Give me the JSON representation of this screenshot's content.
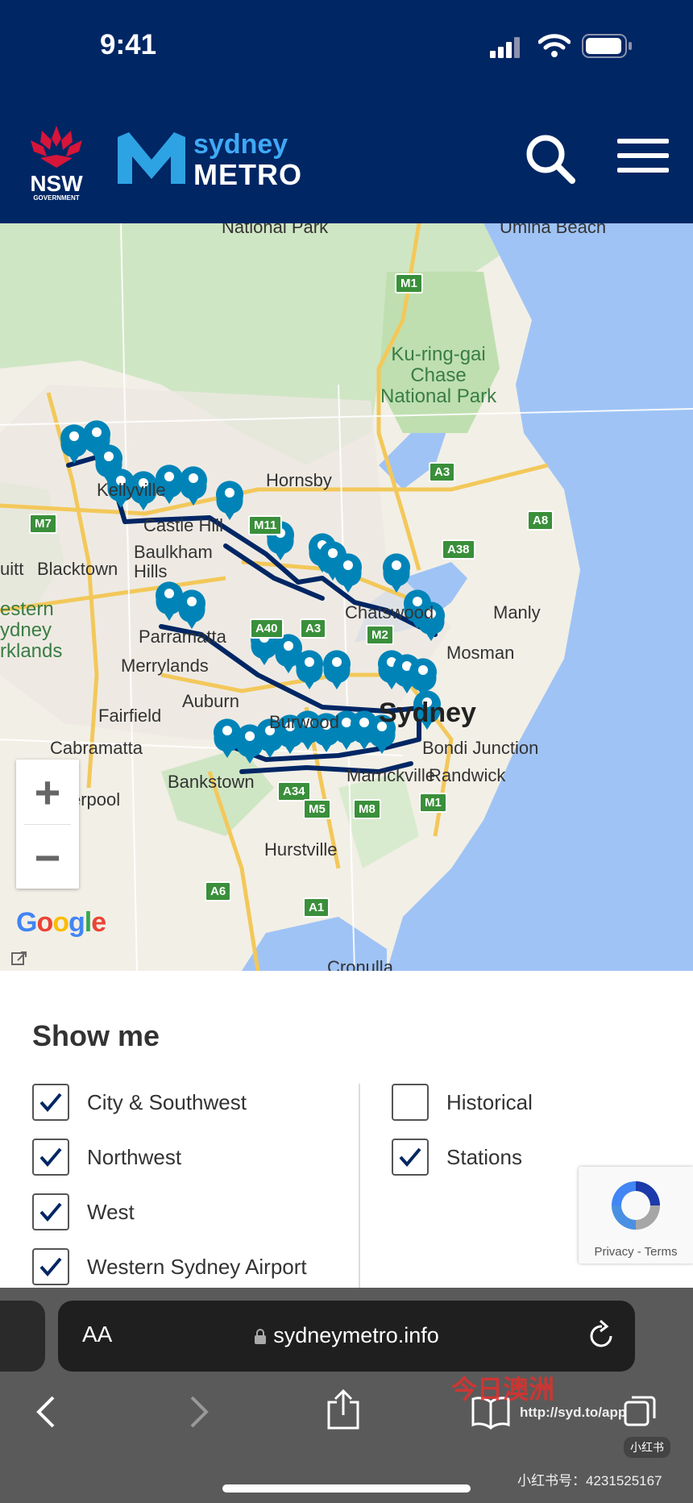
{
  "status_bar": {
    "time": "9:41"
  },
  "header": {
    "nsw_logo_text": "NSW",
    "nsw_logo_subtext": "GOVERNMENT",
    "metro_logo_word1": "sydney",
    "metro_logo_word2": "METRO"
  },
  "map": {
    "labels": {
      "hornsby": "Hornsby",
      "blacktown": "Blacktown",
      "baulkham_hills": "Baulkham\nHills",
      "castle_hill": "Castle Hill",
      "kellyville": "Kellyville",
      "parramatta": "Parramatta",
      "merrylands": "Merrylands",
      "auburn": "Auburn",
      "fairfield": "Fairfield",
      "cabramatta": "Cabramatta",
      "bankstown": "Bankstown",
      "burwood": "Burwood",
      "sydney": "Sydney",
      "bondi_junction": "Bondi Junction",
      "randwick": "Randwick",
      "manly": "Manly",
      "mosman": "Mosman",
      "chatswood": "Chatswood",
      "hurstville": "Hurstville",
      "liverpool": "erpool",
      "western_parklands": "estern\nydney\nrklands",
      "ku_ring_gai": "Ku-ring-gai\nChase\nNational Park",
      "national_park_top": "National Park",
      "umina_beach": "Umina Beach",
      "marrickville": "Marrickville",
      "cronulla": "Cronulla",
      "uitt": "uitt"
    },
    "shields": [
      "M1",
      "A3",
      "M7",
      "M11",
      "A38",
      "A8",
      "A40",
      "A3",
      "M2",
      "A34",
      "M5",
      "M8",
      "M1",
      "A6",
      "A1"
    ],
    "zoom_in": "+",
    "zoom_out": "−",
    "google_letters": [
      "G",
      "o",
      "o",
      "g",
      "l",
      "e"
    ]
  },
  "filters": {
    "title": "Show me",
    "left": [
      {
        "label": "City & Southwest",
        "checked": true
      },
      {
        "label": "Northwest",
        "checked": true
      },
      {
        "label": "West",
        "checked": true
      },
      {
        "label": "Western Sydney Airport",
        "checked": true
      }
    ],
    "right": [
      {
        "label": "Historical",
        "checked": false
      },
      {
        "label": "Stations",
        "checked": true
      }
    ]
  },
  "recaptcha": {
    "links": "Privacy - Terms"
  },
  "browser": {
    "text_size": "AA",
    "url": "sydneymetro.info"
  },
  "watermarks": {
    "logo": "今日澳洲",
    "url": "http://syd.to/app",
    "xhs_badge": "小红书",
    "xhs_id": "小红书号：4231525167"
  }
}
